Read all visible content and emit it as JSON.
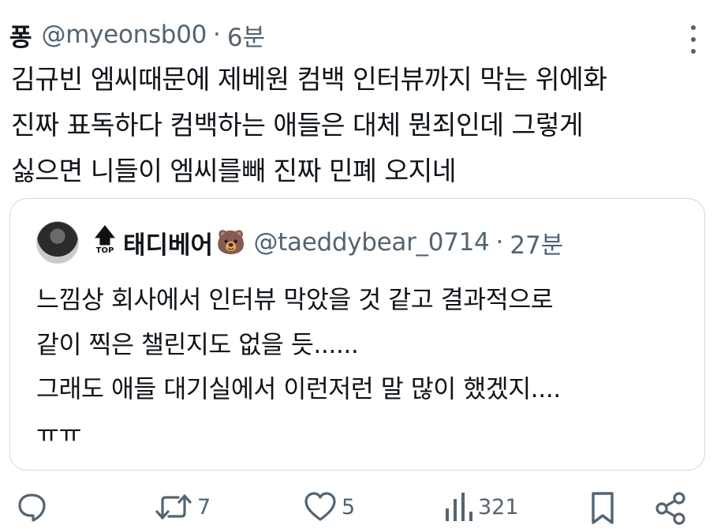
{
  "tweet": {
    "name": "퐁",
    "handle": "@myeonsb00",
    "separator": "·",
    "time": "6분",
    "lines": [
      "김규빈 엠씨때문에 제베원 컴백 인터뷰까지 막는 위에화",
      "진짜 표독하다 컴백하는 애들은 대체 뭔죄인데 그렇게",
      "싫으면 니들이 엠씨를빼 진짜 민폐 오지네"
    ]
  },
  "quote": {
    "badge_text": "TOP",
    "name": "태디베어",
    "emoji": "🐻",
    "handle": "@taeddybear_0714",
    "separator": "·",
    "time": "27분",
    "lines": [
      "느낌상 회사에서 인터뷰 막았을 것 같고 결과적으로",
      "같이 찍은 챌린지도 없을 듯......",
      "그래도 애들 대기실에서 이런저런 말 많이 했겠지....",
      "ㅠㅠ"
    ]
  },
  "actions": {
    "reply_icon": "reply-icon",
    "retweet_count": "7",
    "like_count": "5",
    "views_count": "321",
    "colors": {
      "secondary": "#536471",
      "border": "#cfd9de",
      "text": "#0f1419"
    }
  }
}
